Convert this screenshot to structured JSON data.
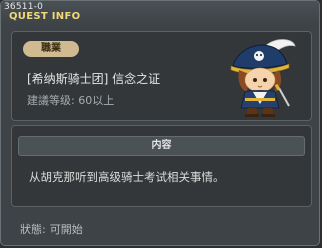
{
  "window": {
    "quest_id": "36511-0",
    "title": "QUEST INFO"
  },
  "quest": {
    "job_label": "職業",
    "name": "[希纳斯骑士团] 信念之证",
    "level_requirement": "建議等级: 60以上"
  },
  "content": {
    "header": "内容",
    "text": "从胡克那听到高级骑士考试相关事情。"
  },
  "status": {
    "label": "狀態:",
    "value": "可開始"
  },
  "colors": {
    "title": "#f1d97a",
    "job_badge": "#cfba92",
    "window_bg": "#3d4347",
    "panel_bg": "#333739"
  },
  "npc": {
    "icon": "pirate-captain-npc-icon"
  }
}
